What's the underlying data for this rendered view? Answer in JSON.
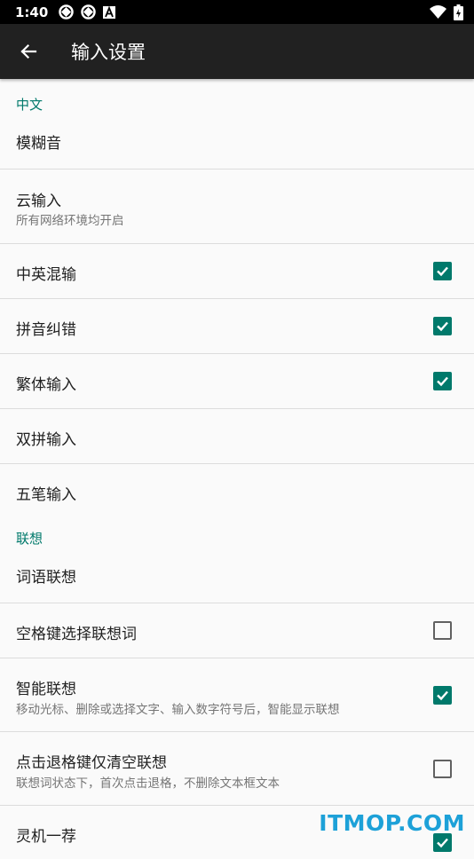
{
  "status_bar": {
    "time": "1:40",
    "left_icons": [
      "sync-icon",
      "sync-icon",
      "text-a-icon"
    ],
    "right_icons": [
      "wifi-icon",
      "battery-charging-icon"
    ]
  },
  "toolbar": {
    "title": "输入设置",
    "back_icon": "arrow-back-icon"
  },
  "colors": {
    "accent": "#00796b",
    "toolbar_bg": "#212121",
    "background": "#fafafa"
  },
  "sections": [
    {
      "header": "中文",
      "items": [
        {
          "title": "模糊音"
        },
        {
          "title": "云输入",
          "summary": "所有网络环境均开启"
        },
        {
          "title": "中英混输",
          "checked": true
        },
        {
          "title": "拼音纠错",
          "checked": true
        },
        {
          "title": "繁体输入",
          "checked": true
        },
        {
          "title": "双拼输入"
        },
        {
          "title": "五笔输入"
        }
      ]
    },
    {
      "header": "联想",
      "items": [
        {
          "title": "词语联想"
        },
        {
          "title": "空格键选择联想词",
          "checked": false
        },
        {
          "title": "智能联想",
          "summary": "移动光标、删除或选择文字、输入数字符号后，智能显示联想",
          "checked": true
        },
        {
          "title": "点击退格键仅清空联想",
          "summary": "联想词状态下，首次点击退格，不删除文本框文本",
          "checked": false
        },
        {
          "title": "灵机一荐",
          "checked": true
        }
      ]
    }
  ],
  "watermark": "ITMOP.COM"
}
